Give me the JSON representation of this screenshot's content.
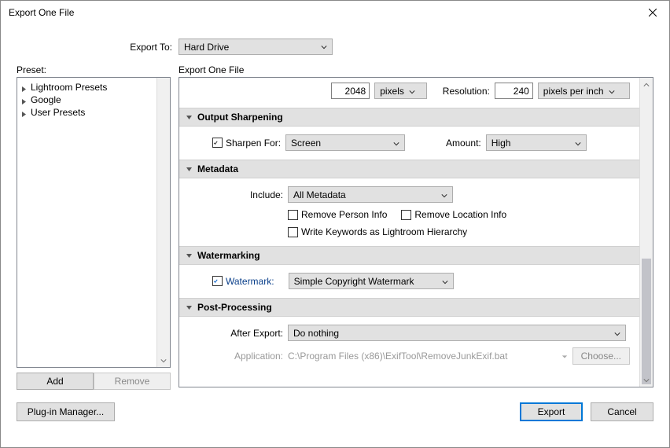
{
  "window": {
    "title": "Export One File"
  },
  "topbar": {
    "export_to_label": "Export To:",
    "export_to_value": "Hard Drive"
  },
  "preset": {
    "label": "Preset:",
    "items": [
      "Lightroom Presets",
      "Google",
      "User Presets"
    ],
    "add_btn": "Add",
    "remove_btn": "Remove"
  },
  "settings_title": "Export One File",
  "image_sizing": {
    "value_px": "2048",
    "unit": "pixels",
    "resolution_label": "Resolution:",
    "resolution_value": "240",
    "resolution_unit": "pixels per inch"
  },
  "output_sharpening": {
    "header": "Output Sharpening",
    "sharpen_chk": "Sharpen For:",
    "sharpen_for_value": "Screen",
    "amount_label": "Amount:",
    "amount_value": "High"
  },
  "metadata": {
    "header": "Metadata",
    "include_label": "Include:",
    "include_value": "All Metadata",
    "remove_person": "Remove Person Info",
    "remove_location": "Remove Location Info",
    "write_keywords": "Write Keywords as Lightroom Hierarchy"
  },
  "watermarking": {
    "header": "Watermarking",
    "watermark_chk": "Watermark:",
    "watermark_value": "Simple Copyright Watermark"
  },
  "post_processing": {
    "header": "Post-Processing",
    "after_export_label": "After Export:",
    "after_export_value": "Do nothing",
    "application_label": "Application:",
    "application_value": "C:\\Program Files (x86)\\ExifTool\\RemoveJunkExif.bat",
    "choose_btn": "Choose..."
  },
  "footer": {
    "plugin_manager": "Plug-in Manager...",
    "export": "Export",
    "cancel": "Cancel"
  }
}
